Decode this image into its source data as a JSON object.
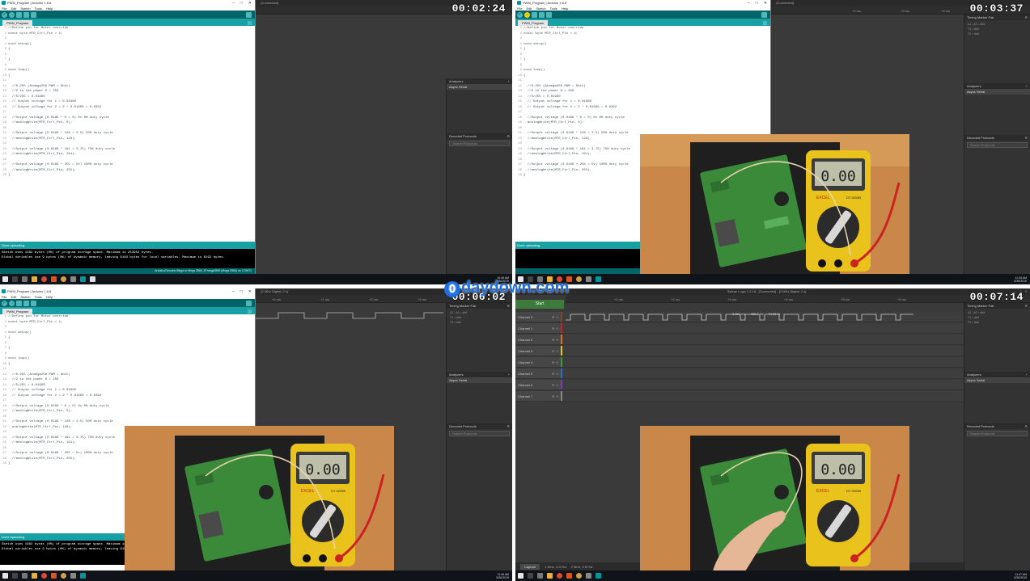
{
  "timestamps": [
    "00:02:24",
    "00:03:37",
    "00:06:02",
    "00:07:14"
  ],
  "watermark": "0daydown.com",
  "watermark_zero": "0",
  "watermark_rest": "daydown.com",
  "colors": {
    "arduino_teal": "#006468",
    "arduino_bar": "#17a1a5",
    "logic_bg": "#3a3a3a",
    "start_green": "#3d7a3c"
  },
  "arduino": {
    "title": "PWM_Program | Arduino 1.8.8",
    "menu": [
      "File",
      "Edit",
      "Sketch",
      "Tools",
      "Help"
    ],
    "tab": "PWM_Program",
    "status": "Done uploading.",
    "console": [
      "Sketch uses 1682 bytes (0%) of program storage space. Maximum is 253952 bytes.",
      "Global variables use 9 bytes (0%) of dynamic memory, leaving 8183 bytes for local variables. Maximum is 8192 bytes."
    ],
    "board": "Arduino/Genuino Mega or Mega 2560, ATmega2560 (Mega 2560) on COM72",
    "code_a": [
      "//Define pin for Motor override",
      "const byte MTR_Ctrl_Pin = 4;",
      "",
      "void setup()",
      "{",
      "",
      "}",
      "",
      "void loop()",
      "{",
      "",
      "  //0-255 (Atmega256 PWM = 8bit)",
      "  //2 to the power 8 = 256",
      "  //5/255 = 0.01960",
      "  // Output voltage for 1 = 0.01960",
      "  // Output voltage for 2 = 2 * 0.01960 = 0.0392",
      "",
      "  //Output voltage (0.0196 * 0 = 0) 0v 0% duty cycle",
      "  //analogWrite(MTR_Ctrl_Pin, 0);",
      "",
      "  //Output voltage (0.0196 * 128 = 2.5) 50% duty cycle",
      "  //analogWrite(MTR_Ctrl_Pin, 128);",
      "",
      "  //Output voltage (0.0196 * 191 = 3.75) 75% duty cycle",
      "  //analogWrite(MTR_Ctrl_Pin, 191);",
      "",
      "  //Output voltage (0.0196 * 255 = 5v) 100% duty cycle",
      "  //analogWrite(MTR_Ctrl_Pin, 255);",
      "}"
    ],
    "code_b": [
      "//Define pin for Motor override",
      "const byte MTR_Ctrl_Pin = 4;",
      "",
      "void setup()",
      "{",
      "",
      "}",
      "",
      "void loop()",
      "{",
      "",
      "  //0-255 (Atmega256 PWM = 8bit)",
      "  //2 to the power 8 = 256",
      "  //5/255 = 0.01960",
      "  // Output voltage for 1 = 0.01960",
      "  // Output voltage for 2 = 2 * 0.01960 = 0.0392",
      "",
      "  //Output voltage (0.0196 * 0 = 0) 0v 0% duty cycle",
      "  analogWrite(MTR_Ctrl_Pin, 0);",
      "",
      "  //Output voltage (0.0196 * 128 = 2.5) 50% duty cycle",
      "  //analogWrite(MTR_Ctrl_Pin, 128);",
      "",
      "  //Output voltage (0.0196 * 191 = 3.75) 75% duty cycle",
      "  //analogWrite(MTR_Ctrl_Pin, 191);",
      "",
      "  //Output voltage (0.0196 * 255 = 5v) 100% duty cycle",
      "  //analogWrite(MTR_Ctrl_Pin, 255);",
      "}"
    ],
    "code_c": [
      "//Define pin for Motor override",
      "const byte MTR_Ctrl_Pin = 4;",
      "",
      "void setup()",
      "{",
      "",
      "}",
      "",
      "void loop()",
      "{",
      "",
      "  //0-255 (Atmega256 PWM = 8bit)",
      "  //2 to the power 8 = 256",
      "  //5/255 = 0.01960",
      "  // Output voltage for 1 = 0.01960",
      "  // Output voltage for 2 = 2 * 0.01960 = 0.0392",
      "",
      "  //Output voltage (0.0196 * 0 = 0) 0v 0% duty cycle",
      "  //analogWrite(MTR_Ctrl_Pin, 0);",
      "",
      "  //Output voltage (0.0196 * 128 = 2.5) 50% duty cycle",
      "  analogWrite(MTR_Ctrl_Pin, 128);",
      "",
      "  //Output voltage (0.0196 * 191 = 3.75) 75% duty cycle",
      "  //analogWrite(MTR_Ctrl_Pin, 191);",
      "",
      "  //Output voltage (0.0196 * 255 = 5v) 100% duty cycle",
      "  //analogWrite(MTR_Ctrl_Pin, 255);",
      "}"
    ]
  },
  "logic": {
    "title_full": "Saleae Logic 1.2.18 - [Connected] - [2 MHz Digital, 2 s]",
    "title_short": "- [Connected]",
    "title_right": "- [2 MHz Digital, 2 s]",
    "start": "Start",
    "panels": {
      "timing": "Timing Marker Pair",
      "analyzers": "Analyzers",
      "async": "Async Serial",
      "decoded": "Decoded Protocols",
      "search": "Search Protocols"
    },
    "timing_rows": [
      "A1  -  A2  =  ###",
      "T1  =  ###",
      "T2  =  ###"
    ],
    "channels": [
      "Channel 0",
      "Channel 1",
      "Channel 2",
      "Channel 3",
      "Channel 4",
      "Channel 5",
      "Channel 6",
      "Channel 7"
    ],
    "measure": [
      "1.024 ms",
      "488.1 Hz",
      "74.95 %"
    ],
    "capture": "Capture",
    "rate1": "2 MHz, 4 M Sa",
    "rate2": "2 MHz, 4 M Sa",
    "ruler": [
      "+0 ms",
      "+1 ms",
      "+2 ms",
      "+3 ms",
      "+4 ms",
      "+5 ms",
      "+6 ms",
      "+7 ms"
    ]
  },
  "meter": {
    "reading": "0.00",
    "brand": "EXCEL",
    "model": "DT-9205B"
  },
  "taskbar": {
    "times": [
      "10:45 AM",
      "11:44 AM",
      "11:46 AM",
      "11:47 AM"
    ],
    "date": "5/30/2019"
  }
}
